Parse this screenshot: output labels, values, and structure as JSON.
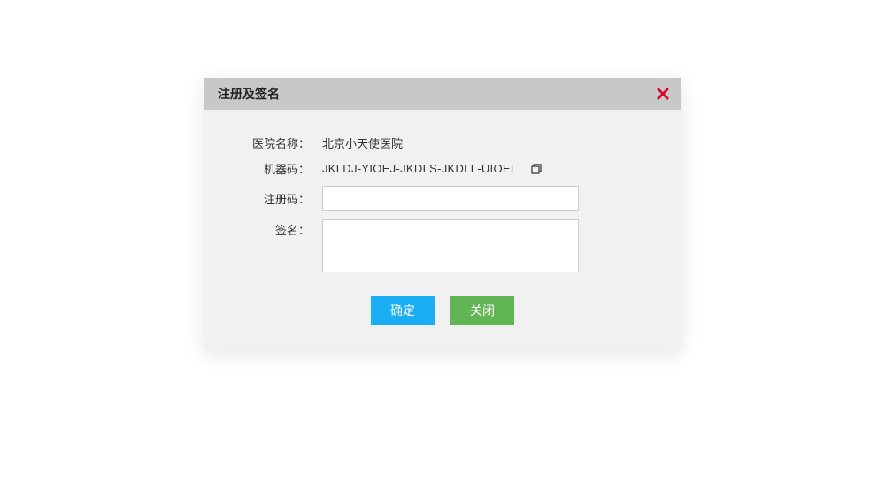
{
  "dialog": {
    "title": "注册及签名",
    "hospital": {
      "label": "医院名称：",
      "value": "北京小天使医院"
    },
    "machine": {
      "label": "机器码：",
      "value": "JKLDJ-YIOEJ-JKDLS-JKDLL-UIOEL"
    },
    "registrationCode": {
      "label": "注册码：",
      "value": ""
    },
    "signature": {
      "label": "签名：",
      "value": ""
    },
    "buttons": {
      "confirm": "确定",
      "close": "关闭"
    }
  }
}
